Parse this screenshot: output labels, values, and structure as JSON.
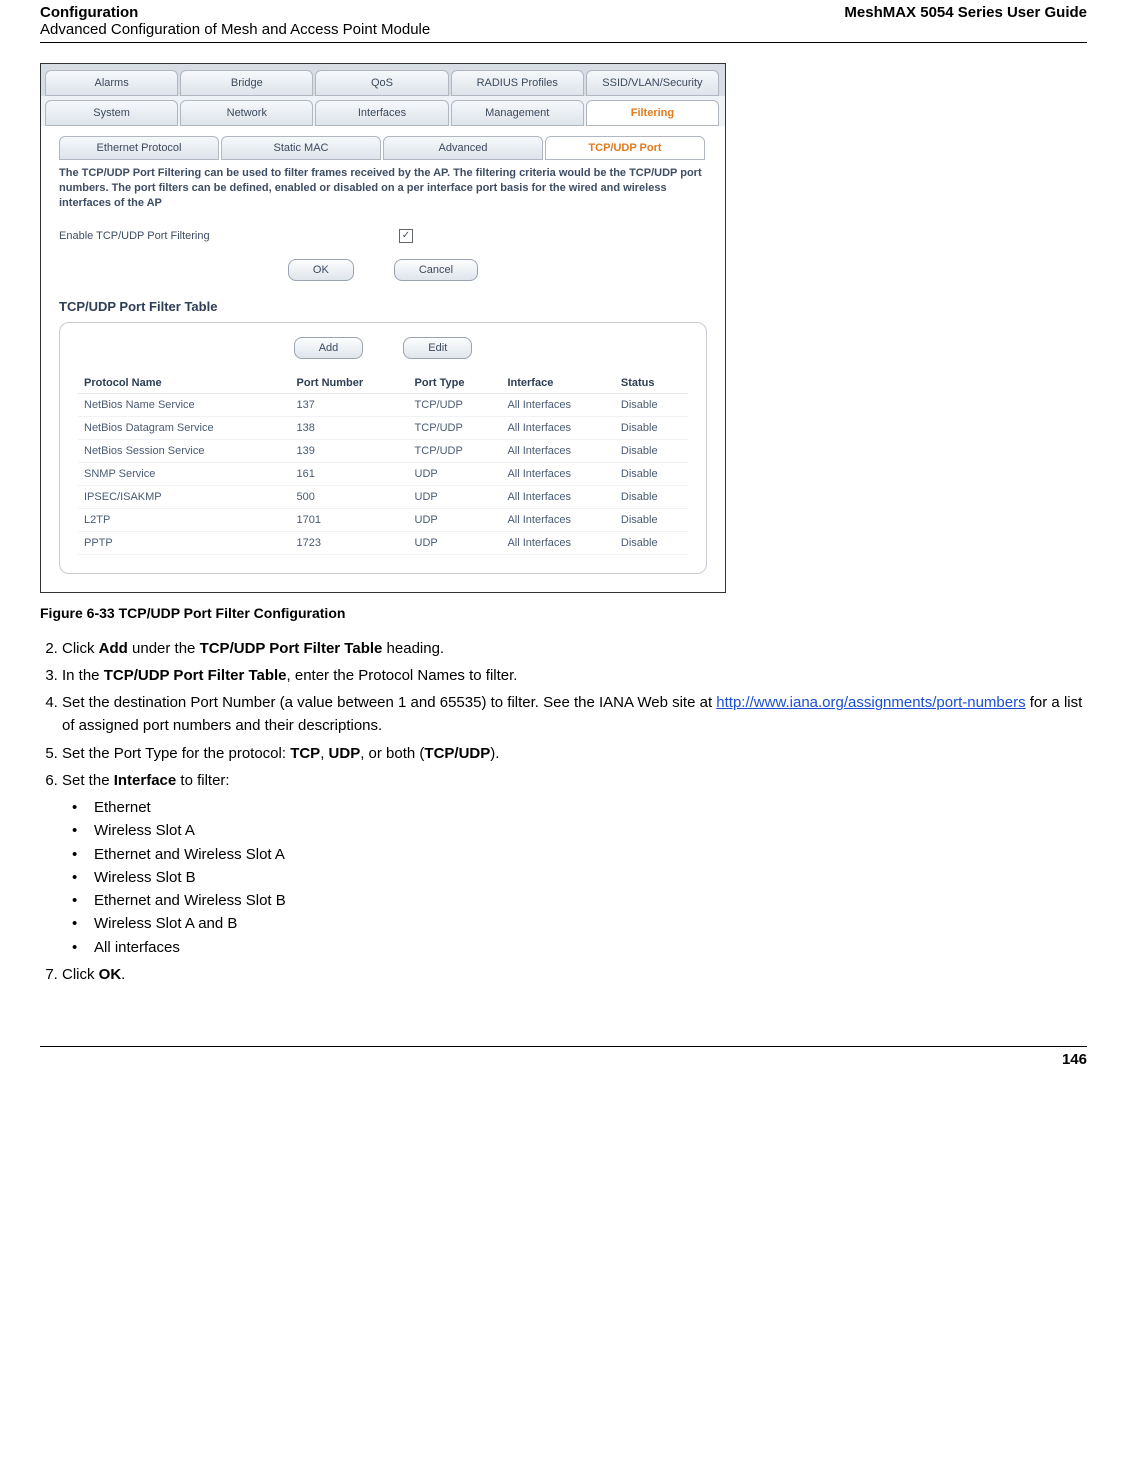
{
  "header": {
    "title": "Configuration",
    "subtitle": "Advanced Configuration of Mesh and Access Point Module",
    "guide": "MeshMAX 5054 Series User Guide"
  },
  "shot": {
    "topTabs": [
      "Alarms",
      "Bridge",
      "QoS",
      "RADIUS Profiles",
      "SSID/VLAN/Security"
    ],
    "secondTabs": [
      "System",
      "Network",
      "Interfaces",
      "Management",
      "Filtering"
    ],
    "secondActive": "Filtering",
    "subTabs": [
      "Ethernet Protocol",
      "Static MAC",
      "Advanced",
      "TCP/UDP Port"
    ],
    "subActive": "TCP/UDP Port",
    "desc": "The TCP/UDP Port Filtering can be used to filter frames received by the AP. The filtering criteria would be the TCP/UDP port numbers. The port filters can be defined, enabled or disabled on a per interface port basis for the wired and wireless interfaces of the AP",
    "enableLabel": "Enable TCP/UDP Port Filtering",
    "enableChecked": true,
    "btnOK": "OK",
    "btnCancel": "Cancel",
    "sectionTitle": "TCP/UDP Port Filter Table",
    "btnAdd": "Add",
    "btnEdit": "Edit",
    "columns": [
      "Protocol Name",
      "Port Number",
      "Port Type",
      "Interface",
      "Status"
    ],
    "rows": [
      {
        "name": "NetBios Name Service",
        "port": "137",
        "type": "TCP/UDP",
        "iface": "All Interfaces",
        "status": "Disable"
      },
      {
        "name": "NetBios Datagram Service",
        "port": "138",
        "type": "TCP/UDP",
        "iface": "All Interfaces",
        "status": "Disable"
      },
      {
        "name": "NetBios Session Service",
        "port": "139",
        "type": "TCP/UDP",
        "iface": "All Interfaces",
        "status": "Disable"
      },
      {
        "name": "SNMP Service",
        "port": "161",
        "type": "UDP",
        "iface": "All Interfaces",
        "status": "Disable"
      },
      {
        "name": "IPSEC/ISAKMP",
        "port": "500",
        "type": "UDP",
        "iface": "All Interfaces",
        "status": "Disable"
      },
      {
        "name": "L2TP",
        "port": "1701",
        "type": "UDP",
        "iface": "All Interfaces",
        "status": "Disable"
      },
      {
        "name": "PPTP",
        "port": "1723",
        "type": "UDP",
        "iface": "All Interfaces",
        "status": "Disable"
      }
    ]
  },
  "caption": "Figure 6-33 TCP/UDP Port Filter Configuration",
  "steps": {
    "s2a": "Click ",
    "s2b": "Add",
    "s2c": " under the ",
    "s2d": "TCP/UDP Port Filter Table",
    "s2e": " heading.",
    "s3a": "In the ",
    "s3b": "TCP/UDP Port Filter Table",
    "s3c": ", enter the Protocol Names to filter.",
    "s4a": "Set the destination Port Number (a value between 1 and 65535) to filter. See the IANA Web site at ",
    "s4link": "http://www.iana.org/assignments/port-numbers",
    "s4b": " for a list of assigned port numbers and their descriptions.",
    "s5a": "Set the Port Type for the protocol: ",
    "s5b": "TCP",
    "s5c": ", ",
    "s5d": "UDP",
    "s5e": ", or both (",
    "s5f": "TCP/UDP",
    "s5g": ").",
    "s6a": "Set the ",
    "s6b": "Interface",
    "s6c": " to filter:",
    "bullets": [
      "Ethernet",
      "Wireless Slot A",
      "Ethernet and Wireless Slot A",
      "Wireless Slot B",
      "Ethernet and Wireless Slot B",
      "Wireless Slot A and B",
      "All interfaces"
    ],
    "s7a": "Click ",
    "s7b": "OK",
    "s7c": "."
  },
  "footer": {
    "page": "146"
  }
}
